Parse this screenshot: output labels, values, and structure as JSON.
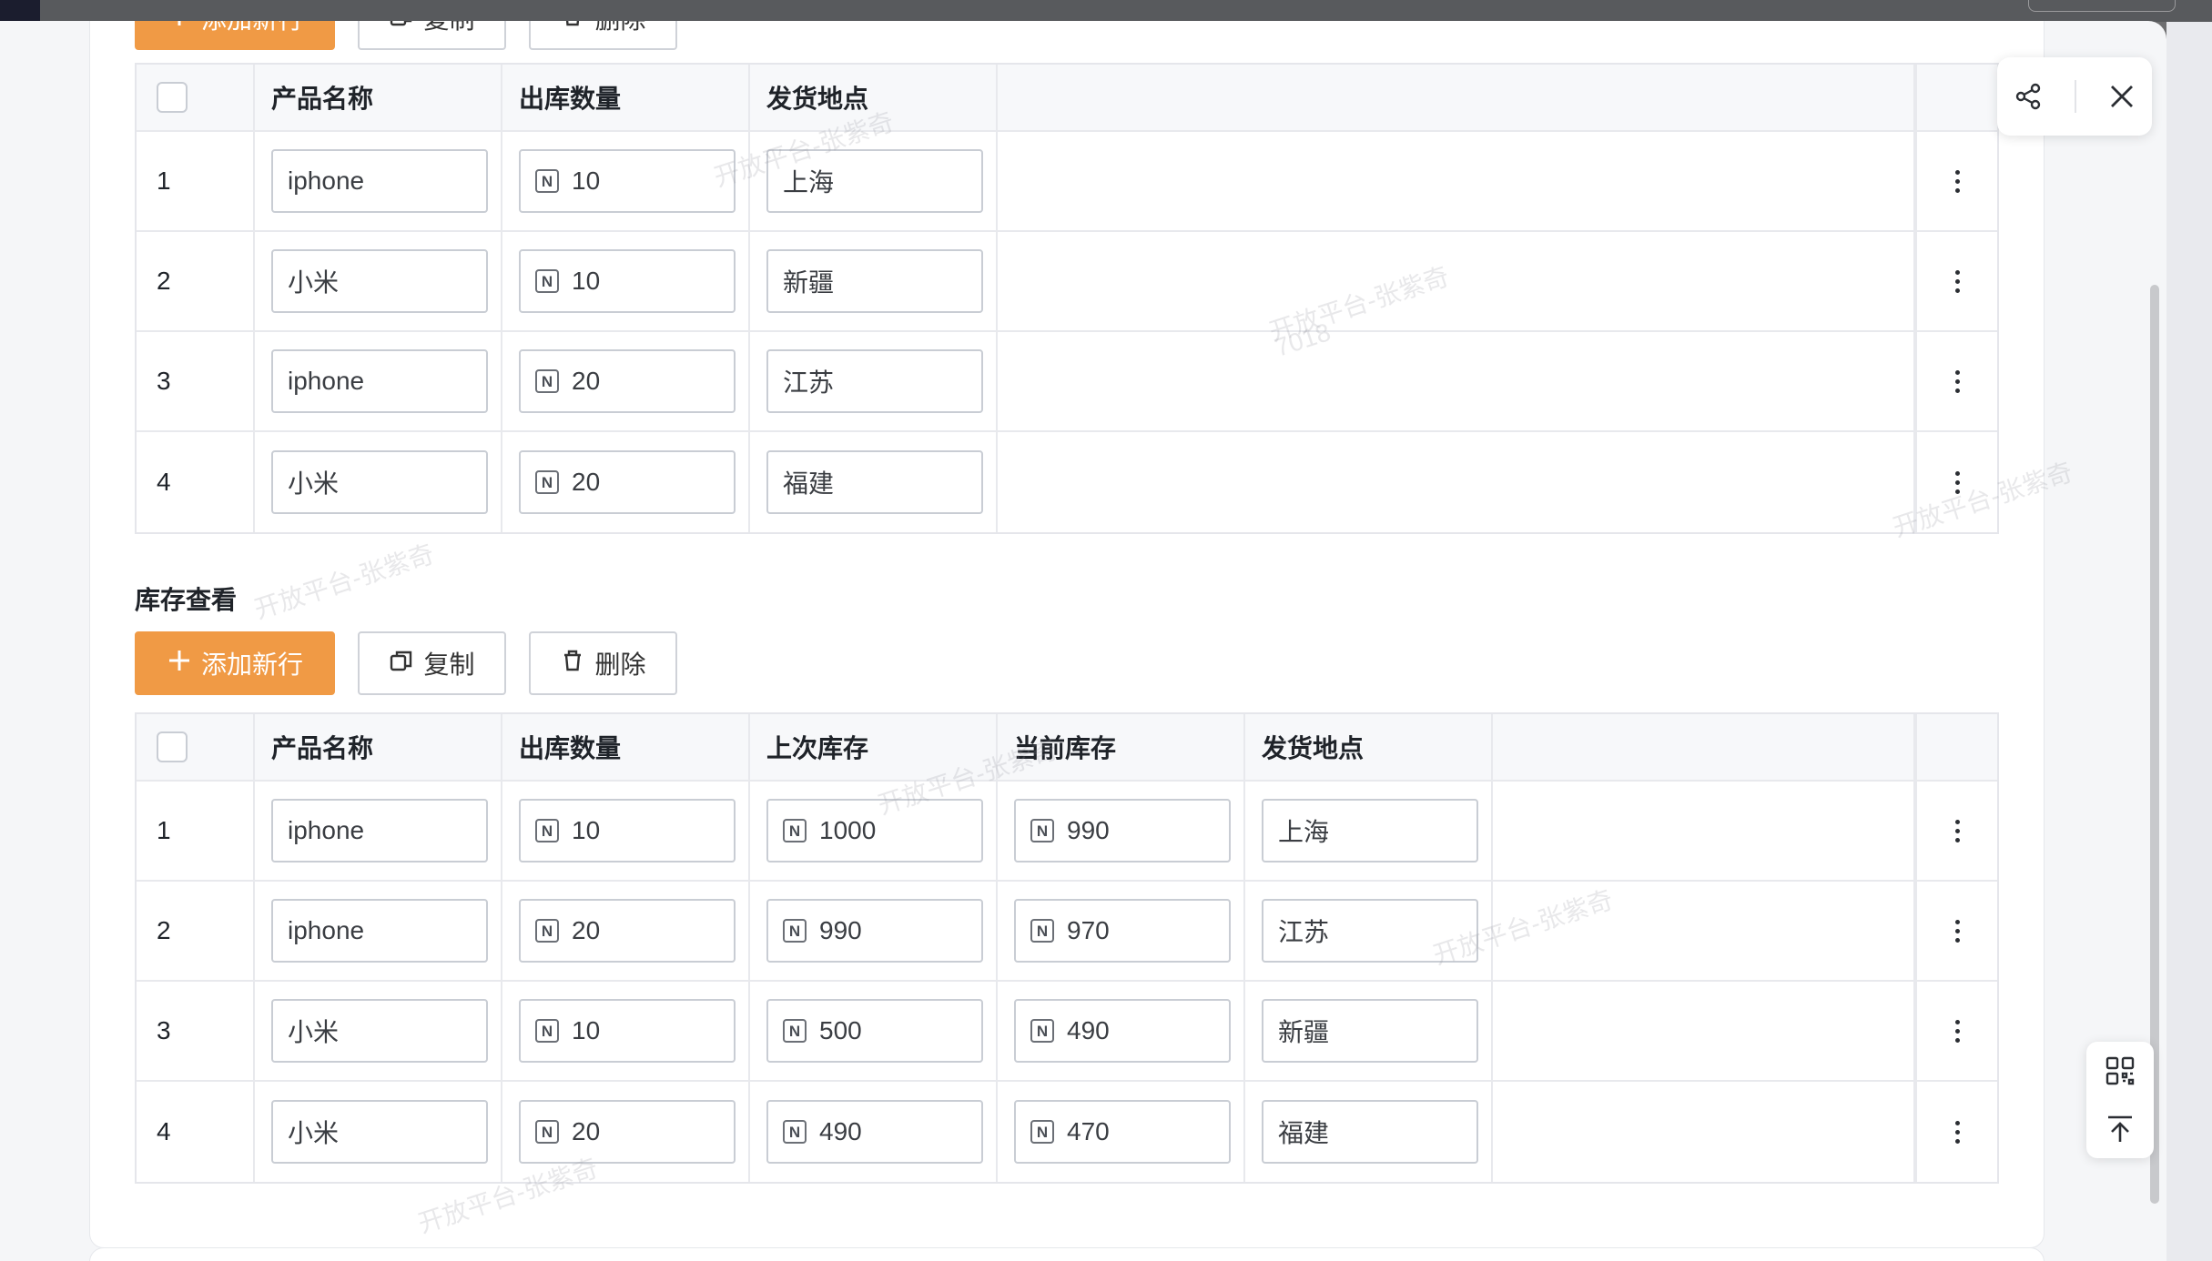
{
  "toolbar": {
    "add_label": "添加新行",
    "copy_label": "复制",
    "delete_label": "删除"
  },
  "outbound_table": {
    "headers": [
      "产品名称",
      "出库数量",
      "发货地点"
    ],
    "rows": [
      {
        "index": "1",
        "product": "iphone",
        "qty": "10",
        "location": "上海"
      },
      {
        "index": "2",
        "product": "小米",
        "qty": "10",
        "location": "新疆"
      },
      {
        "index": "3",
        "product": "iphone",
        "qty": "20",
        "location": "江苏"
      },
      {
        "index": "4",
        "product": "小米",
        "qty": "20",
        "location": "福建"
      }
    ]
  },
  "inventory_section": {
    "title": "库存查看"
  },
  "inventory_table": {
    "headers": [
      "产品名称",
      "出库数量",
      "上次库存",
      "当前库存",
      "发货地点"
    ],
    "rows": [
      {
        "index": "1",
        "product": "iphone",
        "qty": "10",
        "prev_stock": "1000",
        "cur_stock": "990",
        "location": "上海"
      },
      {
        "index": "2",
        "product": "iphone",
        "qty": "20",
        "prev_stock": "990",
        "cur_stock": "970",
        "location": "江苏"
      },
      {
        "index": "3",
        "product": "小米",
        "qty": "10",
        "prev_stock": "500",
        "cur_stock": "490",
        "location": "新疆"
      },
      {
        "index": "4",
        "product": "小米",
        "qty": "20",
        "prev_stock": "490",
        "cur_stock": "470",
        "location": "福建"
      }
    ]
  },
  "number_icon_glyph": "N",
  "watermark": {
    "line1": "开放平台-张紫奇",
    "line2": "7018"
  },
  "colors": {
    "primary": "#f09a45",
    "border": "#c9cdd4"
  }
}
